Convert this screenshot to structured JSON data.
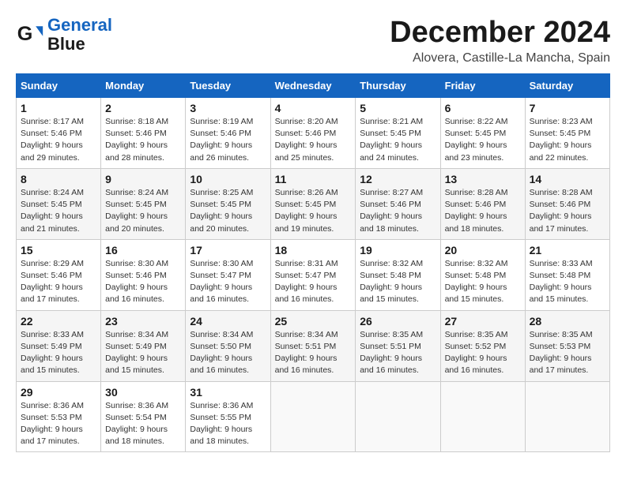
{
  "header": {
    "logo_line1": "General",
    "logo_line2": "Blue",
    "title": "December 2024",
    "subtitle": "Alovera, Castille-La Mancha, Spain"
  },
  "days_of_week": [
    "Sunday",
    "Monday",
    "Tuesday",
    "Wednesday",
    "Thursday",
    "Friday",
    "Saturday"
  ],
  "weeks": [
    [
      {
        "day": "1",
        "sunrise": "8:17 AM",
        "sunset": "5:46 PM",
        "daylight": "9 hours and 29 minutes."
      },
      {
        "day": "2",
        "sunrise": "8:18 AM",
        "sunset": "5:46 PM",
        "daylight": "9 hours and 28 minutes."
      },
      {
        "day": "3",
        "sunrise": "8:19 AM",
        "sunset": "5:46 PM",
        "daylight": "9 hours and 26 minutes."
      },
      {
        "day": "4",
        "sunrise": "8:20 AM",
        "sunset": "5:46 PM",
        "daylight": "9 hours and 25 minutes."
      },
      {
        "day": "5",
        "sunrise": "8:21 AM",
        "sunset": "5:45 PM",
        "daylight": "9 hours and 24 minutes."
      },
      {
        "day": "6",
        "sunrise": "8:22 AM",
        "sunset": "5:45 PM",
        "daylight": "9 hours and 23 minutes."
      },
      {
        "day": "7",
        "sunrise": "8:23 AM",
        "sunset": "5:45 PM",
        "daylight": "9 hours and 22 minutes."
      }
    ],
    [
      {
        "day": "8",
        "sunrise": "8:24 AM",
        "sunset": "5:45 PM",
        "daylight": "9 hours and 21 minutes."
      },
      {
        "day": "9",
        "sunrise": "8:24 AM",
        "sunset": "5:45 PM",
        "daylight": "9 hours and 20 minutes."
      },
      {
        "day": "10",
        "sunrise": "8:25 AM",
        "sunset": "5:45 PM",
        "daylight": "9 hours and 20 minutes."
      },
      {
        "day": "11",
        "sunrise": "8:26 AM",
        "sunset": "5:45 PM",
        "daylight": "9 hours and 19 minutes."
      },
      {
        "day": "12",
        "sunrise": "8:27 AM",
        "sunset": "5:46 PM",
        "daylight": "9 hours and 18 minutes."
      },
      {
        "day": "13",
        "sunrise": "8:28 AM",
        "sunset": "5:46 PM",
        "daylight": "9 hours and 18 minutes."
      },
      {
        "day": "14",
        "sunrise": "8:28 AM",
        "sunset": "5:46 PM",
        "daylight": "9 hours and 17 minutes."
      }
    ],
    [
      {
        "day": "15",
        "sunrise": "8:29 AM",
        "sunset": "5:46 PM",
        "daylight": "9 hours and 17 minutes."
      },
      {
        "day": "16",
        "sunrise": "8:30 AM",
        "sunset": "5:46 PM",
        "daylight": "9 hours and 16 minutes."
      },
      {
        "day": "17",
        "sunrise": "8:30 AM",
        "sunset": "5:47 PM",
        "daylight": "9 hours and 16 minutes."
      },
      {
        "day": "18",
        "sunrise": "8:31 AM",
        "sunset": "5:47 PM",
        "daylight": "9 hours and 16 minutes."
      },
      {
        "day": "19",
        "sunrise": "8:32 AM",
        "sunset": "5:48 PM",
        "daylight": "9 hours and 15 minutes."
      },
      {
        "day": "20",
        "sunrise": "8:32 AM",
        "sunset": "5:48 PM",
        "daylight": "9 hours and 15 minutes."
      },
      {
        "day": "21",
        "sunrise": "8:33 AM",
        "sunset": "5:48 PM",
        "daylight": "9 hours and 15 minutes."
      }
    ],
    [
      {
        "day": "22",
        "sunrise": "8:33 AM",
        "sunset": "5:49 PM",
        "daylight": "9 hours and 15 minutes."
      },
      {
        "day": "23",
        "sunrise": "8:34 AM",
        "sunset": "5:49 PM",
        "daylight": "9 hours and 15 minutes."
      },
      {
        "day": "24",
        "sunrise": "8:34 AM",
        "sunset": "5:50 PM",
        "daylight": "9 hours and 16 minutes."
      },
      {
        "day": "25",
        "sunrise": "8:34 AM",
        "sunset": "5:51 PM",
        "daylight": "9 hours and 16 minutes."
      },
      {
        "day": "26",
        "sunrise": "8:35 AM",
        "sunset": "5:51 PM",
        "daylight": "9 hours and 16 minutes."
      },
      {
        "day": "27",
        "sunrise": "8:35 AM",
        "sunset": "5:52 PM",
        "daylight": "9 hours and 16 minutes."
      },
      {
        "day": "28",
        "sunrise": "8:35 AM",
        "sunset": "5:53 PM",
        "daylight": "9 hours and 17 minutes."
      }
    ],
    [
      {
        "day": "29",
        "sunrise": "8:36 AM",
        "sunset": "5:53 PM",
        "daylight": "9 hours and 17 minutes."
      },
      {
        "day": "30",
        "sunrise": "8:36 AM",
        "sunset": "5:54 PM",
        "daylight": "9 hours and 18 minutes."
      },
      {
        "day": "31",
        "sunrise": "8:36 AM",
        "sunset": "5:55 PM",
        "daylight": "9 hours and 18 minutes."
      },
      null,
      null,
      null,
      null
    ]
  ]
}
